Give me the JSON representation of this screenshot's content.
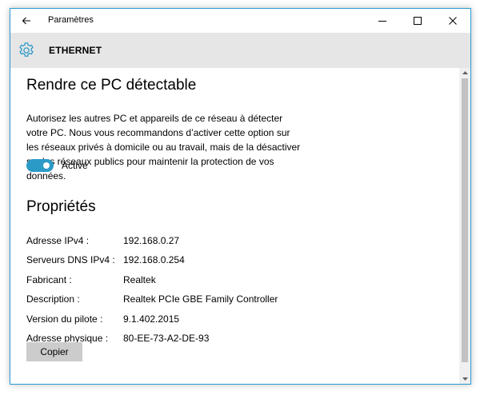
{
  "titlebar": {
    "title": "Paramètres",
    "back_icon": "arrow-left-icon",
    "controls": [
      "minimize-icon",
      "maximize-icon",
      "close-icon"
    ]
  },
  "header": {
    "icon": "gear-icon",
    "title": "ETHERNET",
    "accent_color": "#2b9ac7"
  },
  "discoverable": {
    "title": "Rendre ce PC détectable",
    "description": "Autorisez les autres PC et appareils de ce réseau à détecter votre PC. Nous vous recommandons d’activer cette option sur les réseaux privés à domicile ou au travail, mais de la désactiver sur les réseaux publics pour maintenir la protection de vos données.",
    "toggle_state": "on",
    "toggle_label": "Activé"
  },
  "properties": {
    "title": "Propriétés",
    "rows": [
      {
        "label": "Adresse IPv4 :",
        "value": "192.168.0.27"
      },
      {
        "label": "Serveurs DNS IPv4 :",
        "value": "192.168.0.254"
      },
      {
        "label": "Fabricant :",
        "value": "Realtek"
      },
      {
        "label": "Description :",
        "value": "Realtek PCIe GBE Family Controller"
      },
      {
        "label": "Version du pilote :",
        "value": "9.1.402.2015"
      },
      {
        "label": "Adresse physique :",
        "value": "80-EE-73-A2-DE-93"
      }
    ],
    "copy_label": "Copier"
  }
}
